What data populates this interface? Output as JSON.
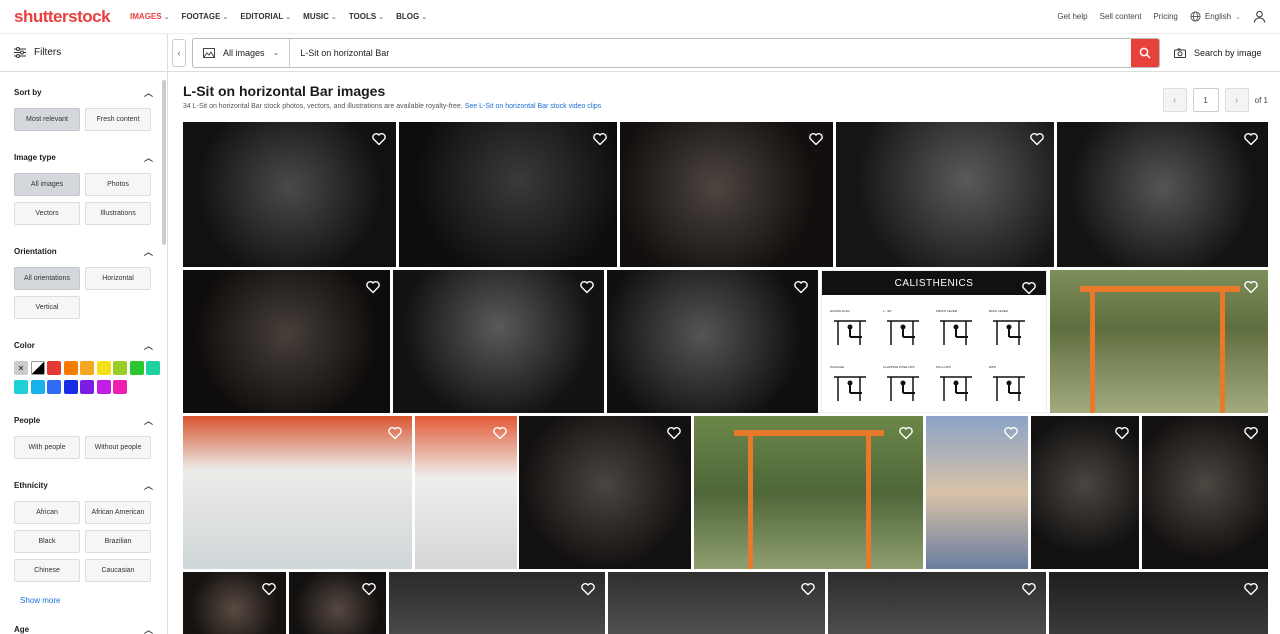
{
  "brand": "shutterstock",
  "nav": [
    {
      "label": "IMAGES",
      "active": true
    },
    {
      "label": "FOOTAGE"
    },
    {
      "label": "EDITORIAL"
    },
    {
      "label": "MUSIC"
    },
    {
      "label": "TOOLS"
    },
    {
      "label": "BLOG"
    }
  ],
  "top_links": {
    "help": "Get help",
    "sell": "Sell content",
    "pricing": "Pricing",
    "language": "English"
  },
  "search": {
    "filters_label": "Filters",
    "collapse_icon": "chevron-left-icon",
    "type_label": "All images",
    "query": "L-Sit on horizontal Bar",
    "search_by_image": "Search by image"
  },
  "sidebar": {
    "sort": {
      "title": "Sort by",
      "options": [
        "Most relevant",
        "Fresh content"
      ],
      "selected": "Most relevant"
    },
    "image_type": {
      "title": "Image type",
      "options": [
        "All images",
        "Photos",
        "Vectors",
        "Illustrations"
      ],
      "selected": "All images"
    },
    "orientation": {
      "title": "Orientation",
      "options": [
        "All orientations",
        "Horizontal",
        "Vertical"
      ],
      "selected": "All orientations"
    },
    "color": {
      "title": "Color",
      "swatches": [
        "#cccccc",
        "#000000",
        "#e53935",
        "#f57c00",
        "#f5a623",
        "#f4e11a",
        "#9ccc2a",
        "#28c82e",
        "#1ecf9f",
        "#1fd1d7",
        "#16b3ea",
        "#2f6cf5",
        "#1a2de6",
        "#7a1ee6",
        "#c21ee6",
        "#ee1eb0"
      ]
    },
    "people": {
      "title": "People",
      "options": [
        "With people",
        "Without people"
      ]
    },
    "ethnicity": {
      "title": "Ethnicity",
      "options": [
        "African",
        "African American",
        "Black",
        "Brazilian",
        "Chinese",
        "Caucasian"
      ],
      "show_more": "Show more"
    },
    "age": {
      "title": "Age"
    }
  },
  "results": {
    "title": "L-Sit on horizontal Bar images",
    "subtitle": "34 L-Sit on horizontal Bar stock photos, vectors, and illustrations are available royalty-free.",
    "video_link": "See L-Sit on horizontal Bar stock video clips",
    "page": "1",
    "of_pages": "of 1",
    "calisthenics_title": "CALISTHENICS",
    "calisthenics_labels": [
      "HUMAN FLAG",
      "L - SIT",
      "FRONT LEVER",
      "BACK LEVER",
      "PLANCHE",
      "CLAPPING PUSH-UPS",
      "PULL-UPS",
      "DIPS"
    ]
  }
}
